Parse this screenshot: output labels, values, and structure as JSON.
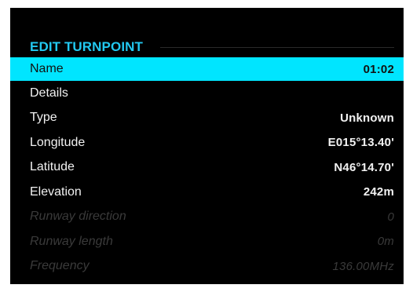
{
  "colors": {
    "accent": "#22c8f0",
    "selected_row_bg": "#00e5ff",
    "background": "#000000",
    "disabled_text": "#3a3a3a"
  },
  "header": {
    "title": "EDIT TURNPOINT"
  },
  "rows": [
    {
      "label": "Name",
      "value": "01:02"
    },
    {
      "label": "Details",
      "value": ""
    },
    {
      "label": "Type",
      "value": "Unknown"
    },
    {
      "label": "Longitude",
      "value": "E015°13.40'"
    },
    {
      "label": "Latitude",
      "value": "N46°14.70'"
    },
    {
      "label": "Elevation",
      "value": "242m"
    },
    {
      "label": "Runway direction",
      "value": "0"
    },
    {
      "label": "Runway length",
      "value": "0m"
    },
    {
      "label": "Frequency",
      "value": "136.00MHz"
    }
  ]
}
